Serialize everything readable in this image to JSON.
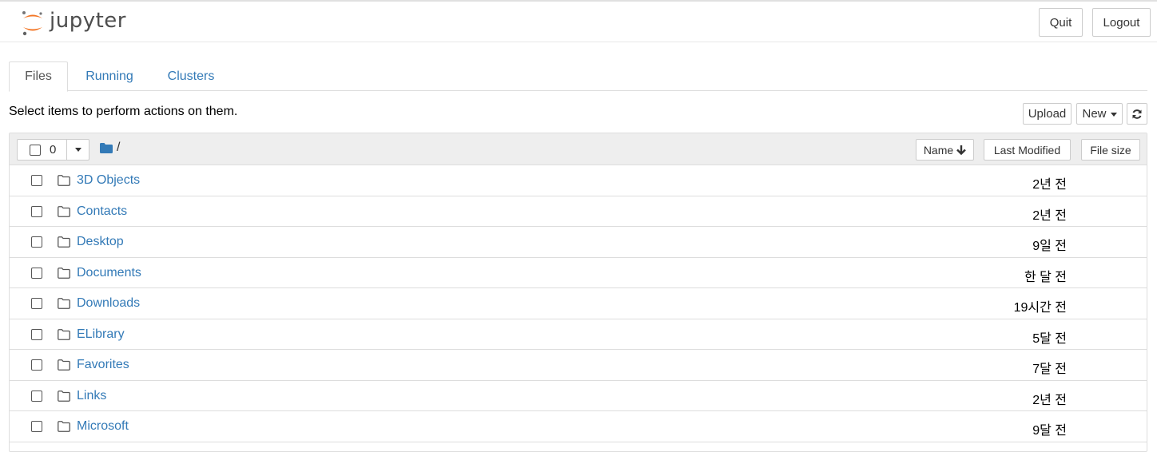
{
  "header": {
    "logo_text": "jupyter",
    "quit_label": "Quit",
    "logout_label": "Logout"
  },
  "tabs": [
    {
      "label": "Files",
      "active": true
    },
    {
      "label": "Running",
      "active": false
    },
    {
      "label": "Clusters",
      "active": false
    }
  ],
  "toolbar": {
    "instructions": "Select items to perform actions on them.",
    "upload_label": "Upload",
    "new_label": "New",
    "refresh_icon": "refresh-icon"
  },
  "list_header": {
    "selected_count": "0",
    "breadcrumb": "/",
    "sort_name_label": "Name",
    "sort_modified_label": "Last Modified",
    "sort_size_label": "File size"
  },
  "files": [
    {
      "name": "3D Objects",
      "modified": "2년 전"
    },
    {
      "name": "Contacts",
      "modified": "2년 전"
    },
    {
      "name": "Desktop",
      "modified": "9일 전"
    },
    {
      "name": "Documents",
      "modified": "한 달 전"
    },
    {
      "name": "Downloads",
      "modified": "19시간 전"
    },
    {
      "name": "ELibrary",
      "modified": "5달 전"
    },
    {
      "name": "Favorites",
      "modified": "7달 전"
    },
    {
      "name": "Links",
      "modified": "2년 전"
    },
    {
      "name": "Microsoft",
      "modified": "9달 전"
    }
  ],
  "colors": {
    "link": "#337ab7",
    "jupyter_orange": "#f37626",
    "header_gray": "#eeeeee"
  }
}
